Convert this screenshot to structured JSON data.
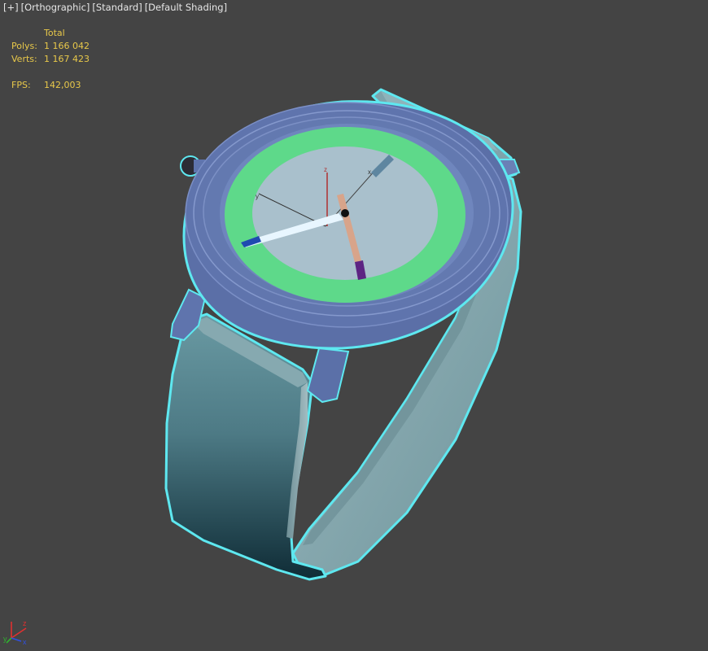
{
  "viewport": {
    "labels": {
      "plus": "[+]",
      "view": "[Orthographic]",
      "material": "[Standard]",
      "shading": "[Default Shading]"
    },
    "stats": {
      "header": "Total",
      "polys_label": "Polys:",
      "polys_value": "1 166 042",
      "verts_label": "Verts:",
      "verts_value": "1 167 423",
      "fps_label": "FPS:",
      "fps_value": "142,003"
    },
    "colors": {
      "background": "#444444",
      "selection_outline": "#5ee8f0",
      "bezel": "#5f74ad",
      "dial_ring": "#5ed98a",
      "dial_face": "#a9c0cc",
      "strap": "#5d8b94",
      "stats_text": "#e8c84a"
    },
    "gizmo": {
      "x": "x",
      "y": "y",
      "z": "z"
    }
  }
}
